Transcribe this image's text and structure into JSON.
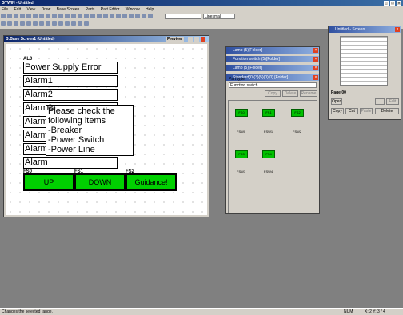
{
  "app": {
    "title": "GTWIN - Untitled"
  },
  "menu": [
    "File",
    "Edit",
    "View",
    "Draw",
    "Base Screen",
    "Parts",
    "Part Editor",
    "Window",
    "Help"
  ],
  "toolbar": {
    "combo1": "",
    "combo2": "Linesmall"
  },
  "editor": {
    "title": "B:Base Screen1 (Untitled)",
    "badge": "Preview"
  },
  "screen": {
    "alarm_tag": "AL0",
    "alarm_title": "Power Supply Error",
    "alarms": [
      "Alarm1",
      "Alarm2",
      "Alarm3",
      "Alarm",
      "Alarm",
      "Alarm",
      "Alarm"
    ],
    "message_tag": "MS0",
    "message_lines": [
      "Please check the following items",
      "-Breaker",
      "-Power Switch",
      "-Power Line"
    ],
    "buttons": [
      {
        "tag": "FS0",
        "label": "UP"
      },
      {
        "tag": "FS1",
        "label": "DOWN"
      },
      {
        "tag": "FS2",
        "label": "Guidance!"
      }
    ]
  },
  "parts_windows": [
    "Lamp (5)[Folder]",
    "Function switch (5)[Folder]",
    "Lamp (5)[Folder]",
    "Standard(0)(3)(5)(0)(0) [Folder]"
  ],
  "parts_panel": {
    "label": "Part type",
    "selected": "Function switch",
    "buttons": [
      "Copy",
      "Delete",
      "Rename"
    ],
    "icons": [
      {
        "text": "FS0",
        "label": "FSW0"
      },
      {
        "text": "FS1",
        "label": "FSW1"
      },
      {
        "text": "FS2",
        "label": "FSW2"
      },
      {
        "text": "FS3",
        "label": "FSW3"
      },
      {
        "text": "FS4",
        "label": "FSW4"
      }
    ]
  },
  "page_window": {
    "title": "Untitled - Screen...",
    "label": "Page 00",
    "buttons": [
      "Open",
      "",
      "Edit",
      "Cut",
      "Copy",
      "Paste",
      "Delete"
    ]
  },
  "status": {
    "text": "Changes the selected range.",
    "num": "NUM",
    "coords": "X: 2   Y: 3 / 4"
  }
}
